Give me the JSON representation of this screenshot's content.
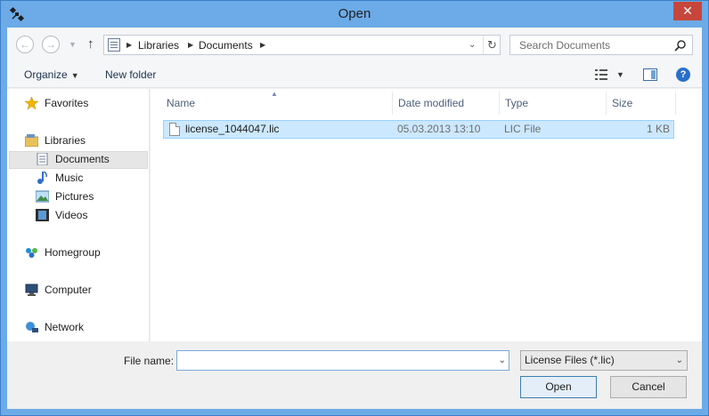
{
  "window": {
    "title": "Open",
    "close_glyph": "✕"
  },
  "nav": {
    "back_glyph": "←",
    "forward_glyph": "→",
    "recent_glyph": "▼",
    "up_glyph": "↑"
  },
  "address": {
    "crumbs": [
      "Libraries",
      "Documents"
    ],
    "separator_glyph": "▶",
    "dropdown_glyph": "⌄",
    "refresh_glyph": "↻"
  },
  "search": {
    "placeholder": "Search Documents"
  },
  "toolbar": {
    "organize_label": "Organize",
    "organize_caret": "▼",
    "new_folder_label": "New folder",
    "views_caret": "▼",
    "help_glyph": "?"
  },
  "sidebar": {
    "items": [
      {
        "label": "Favorites",
        "icon": "star-icon"
      },
      {
        "label": "Libraries",
        "icon": "libraries-icon"
      },
      {
        "label": "Documents",
        "icon": "documents-icon"
      },
      {
        "label": "Music",
        "icon": "music-icon"
      },
      {
        "label": "Pictures",
        "icon": "pictures-icon"
      },
      {
        "label": "Videos",
        "icon": "videos-icon"
      },
      {
        "label": "Homegroup",
        "icon": "homegroup-icon"
      },
      {
        "label": "Computer",
        "icon": "computer-icon"
      },
      {
        "label": "Network",
        "icon": "network-icon"
      }
    ]
  },
  "files": {
    "columns": [
      "Name",
      "Date modified",
      "Type",
      "Size"
    ],
    "sort_glyph": "▲",
    "rows": [
      {
        "name": "license_1044047.lic",
        "date": "05.03.2013 13:10",
        "type": "LIC File",
        "size": "1 KB"
      }
    ]
  },
  "footer": {
    "file_name_label": "File name:",
    "file_name_value": "",
    "dropdown_glyph": "⌄",
    "filter_value": "License Files (*.lic)",
    "open_label": "Open",
    "cancel_label": "Cancel"
  },
  "colors": {
    "frame": "#6cabe7",
    "close": "#c7463b",
    "selection": "#cce8ff",
    "selection_border": "#99d1ff"
  }
}
